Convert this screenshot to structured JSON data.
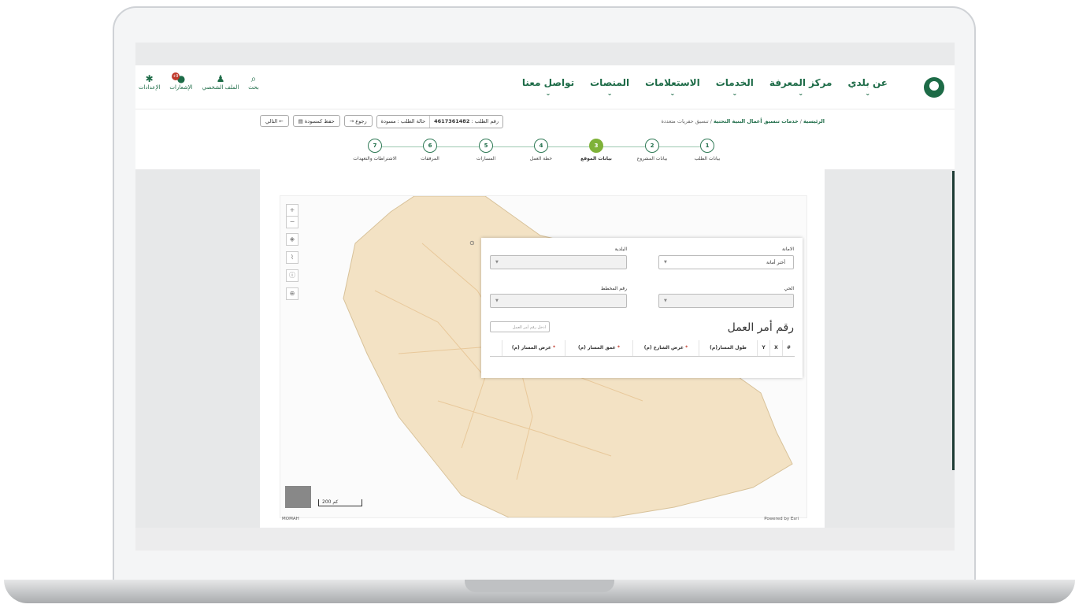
{
  "nav": {
    "items": [
      {
        "label": "عن بلدي"
      },
      {
        "label": "مركز المعرفة"
      },
      {
        "label": "الخدمات"
      },
      {
        "label": "الاستعلامات"
      },
      {
        "label": "المنصات"
      },
      {
        "label": "تواصل معنا"
      }
    ],
    "chevron": "⌄"
  },
  "utils": {
    "search": "بحث",
    "profile": "الملف الشخصي",
    "notifications": "الإشعارات",
    "notifications_badge": "+9",
    "settings": "الإعدادات"
  },
  "breadcrumb": {
    "home": "الرئيسية",
    "service": "خدمات تنسيق أعمال البنية التحتية",
    "current": "تنسيق حفريات متعددة"
  },
  "request": {
    "number_label": "رقم الطلب :",
    "number": "4617361482",
    "status": "حالة الطلب : مسودة"
  },
  "buttons": {
    "back": "رجوع",
    "save_draft": "حفظ كمسودة",
    "next": "التالي"
  },
  "steps": [
    {
      "num": "1",
      "label": "بيانات الطلب"
    },
    {
      "num": "2",
      "label": "بيانات المشروع"
    },
    {
      "num": "3",
      "label": "بيانات الموقع"
    },
    {
      "num": "4",
      "label": "خطة العمل"
    },
    {
      "num": "5",
      "label": "المسارات"
    },
    {
      "num": "6",
      "label": "المرفقات"
    },
    {
      "num": "7",
      "label": "الاشتراطات والتعهدات"
    }
  ],
  "active_step": 3,
  "form": {
    "amana_label": "الامانة",
    "amana_value": "أختر أمانة",
    "baladiya_label": "البلدية",
    "district_label": "الحي",
    "plan_label": "رقم المخطط",
    "work_order_title": "رقم أمر العمل",
    "work_order_placeholder": "ادخل رقم أمر العمل"
  },
  "table": {
    "headers": [
      "#",
      "X",
      "Y",
      "طول المسار(م)",
      "عرض الشارع (م)",
      "عمق المسار (م)",
      "عرض المسار (م)"
    ],
    "required_mark": "*"
  },
  "map": {
    "zoom_in": "+",
    "zoom_out": "−",
    "scale": "200 كم",
    "attribution_left": "MOMAH",
    "attribution_right": "Powered by Esri"
  },
  "colors": {
    "brand": "#1d6b47",
    "active_step": "#7fb239",
    "map_land": "#f3e2c4"
  }
}
